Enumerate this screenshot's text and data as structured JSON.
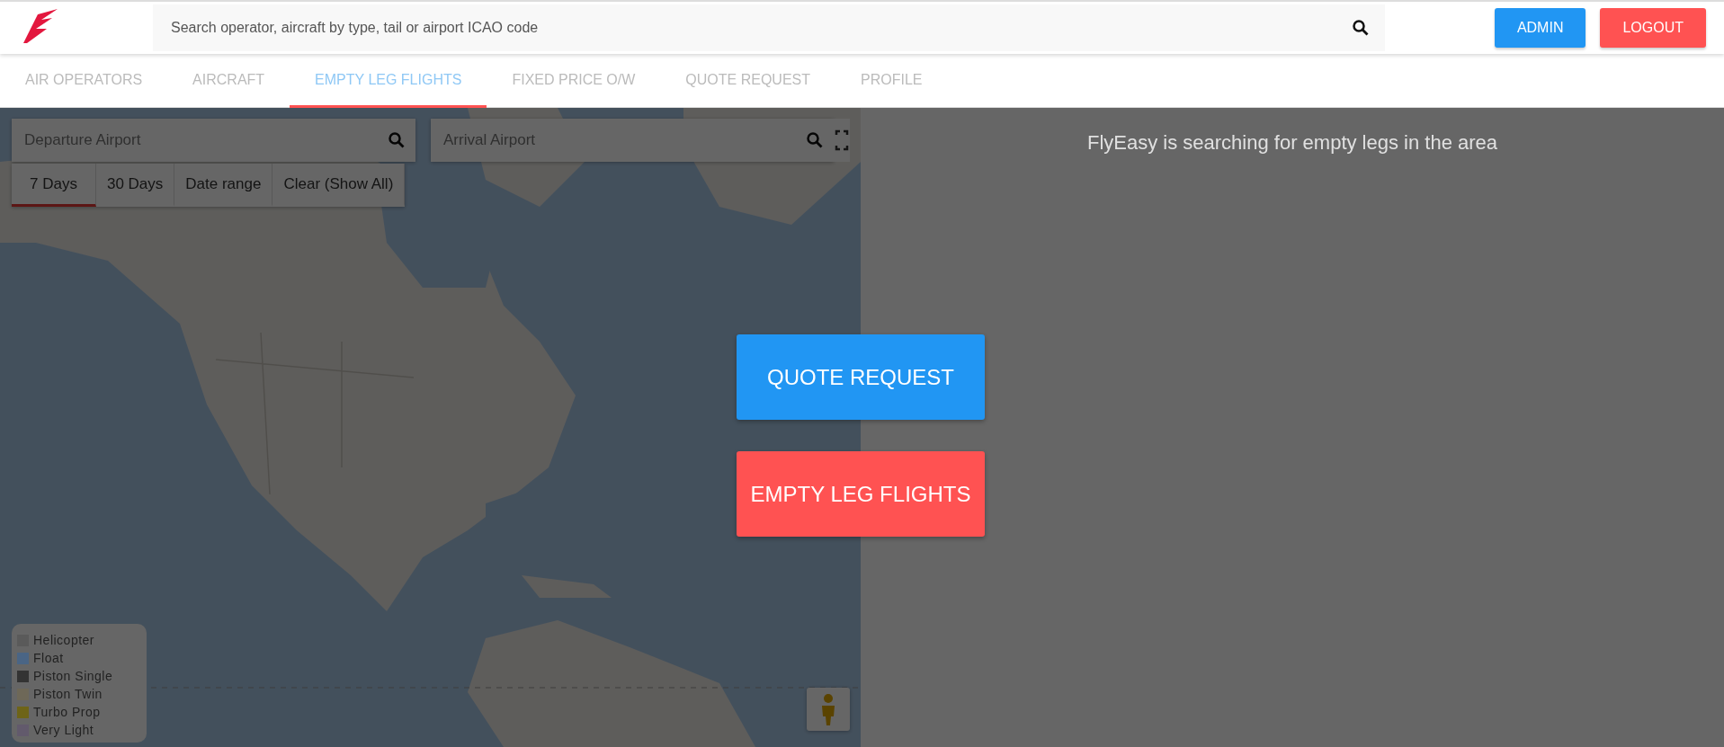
{
  "header": {
    "search": {
      "placeholder": "Search operator, aircraft by type, tail or airport ICAO code"
    },
    "buttons": [
      {
        "label": "ADMIN",
        "kind": "primary"
      },
      {
        "label": "LOGOUT",
        "kind": "danger"
      }
    ]
  },
  "tabs": [
    {
      "label": "AIR OPERATORS",
      "selected": false
    },
    {
      "label": "AIRCRAFT",
      "selected": false
    },
    {
      "label": "EMPTY LEG FLIGHTS",
      "selected": true
    },
    {
      "label": "FIXED PRICE O/W",
      "selected": false
    },
    {
      "label": "QUOTE REQUEST",
      "selected": false
    },
    {
      "label": "PROFILE",
      "selected": false
    }
  ],
  "map": {
    "departure": {
      "placeholder": "Departure Airport"
    },
    "arrival": {
      "placeholder": "Arrival Airport"
    },
    "date_filters": [
      {
        "label": "7 Days",
        "selected": true
      },
      {
        "label": "30 Days",
        "selected": false
      },
      {
        "label": "Date range",
        "selected": false
      },
      {
        "label": "Clear (Show All)",
        "selected": false
      }
    ],
    "legend": [
      {
        "label": "Helicopter",
        "color": "#5a5a5a"
      },
      {
        "label": "Float",
        "color": "#4a6585"
      },
      {
        "label": "Piston Single",
        "color": "#333333"
      },
      {
        "label": "Piston Twin",
        "color": "#6e6858"
      },
      {
        "label": "Turbo Prop",
        "color": "#6e6418"
      },
      {
        "label": "Very Light",
        "color": "#625a6c"
      }
    ]
  },
  "status_text": "FlyEasy is searching for empty legs in the area",
  "dialog_buttons": [
    {
      "label": "QUOTE REQUEST",
      "kind": "primary"
    },
    {
      "label": "EMPTY LEG FLIGHTS",
      "kind": "danger"
    }
  ]
}
